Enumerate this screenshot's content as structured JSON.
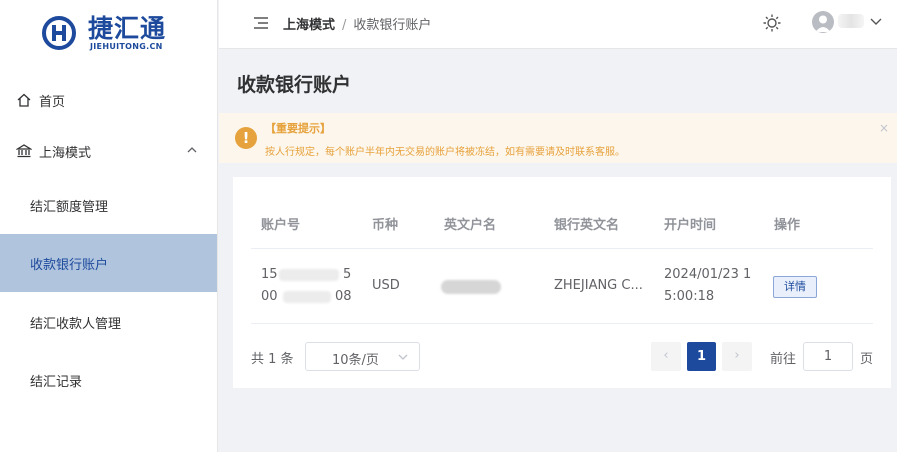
{
  "logo": {
    "cn": "捷汇通",
    "en": "JIEHUITONG.CN"
  },
  "sidebar": {
    "home": "首页",
    "group": "上海模式",
    "items": [
      {
        "label": "结汇额度管理"
      },
      {
        "label": "收款银行账户"
      },
      {
        "label": "结汇收款人管理"
      },
      {
        "label": "结汇记录"
      }
    ]
  },
  "breadcrumb": {
    "level1": "上海模式",
    "sep": "/",
    "level2": "收款银行账户"
  },
  "page": {
    "title": "收款银行账户"
  },
  "alert": {
    "title": "【重要提示】",
    "desc": "按人行规定，每个账户半年内无交易的账户将被冻结，如有需要请及时联系客服。",
    "close": "×"
  },
  "table": {
    "headers": [
      "账户号",
      "币种",
      "英文户名",
      "银行英文名",
      "开户时间",
      "操作"
    ],
    "rows": [
      {
        "account_line1": "15",
        "account_line1_end": "5",
        "account_line2": "00",
        "account_line2_end": "08",
        "currency": "USD",
        "bank_name": "ZHEJIANG C...",
        "open_time_line1": "2024/01/23 1",
        "open_time_line2": "5:00:18",
        "action": "详情"
      }
    ]
  },
  "pagination": {
    "total": "共 1 条",
    "page_size": "10条/页",
    "prev": "‹",
    "current": "1",
    "next": "›",
    "goto_label": "前往",
    "goto_value": "1",
    "page_unit": "页"
  },
  "colors": {
    "brand": "#1d4a9c",
    "active_menu_bg": "#b0c4de",
    "warning": "#e6a23c"
  }
}
